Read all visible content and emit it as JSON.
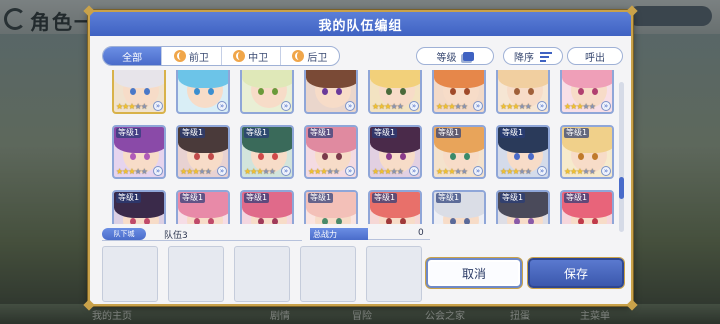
{
  "background": {
    "title": "角色一览",
    "nav_labels": [
      "我的主页",
      "剧情",
      "冒险",
      "公会之家",
      "扭蛋",
      "主菜单"
    ]
  },
  "dialog": {
    "title": "我的队伍编组",
    "filter_tabs": [
      "全部",
      "前卫",
      "中卫",
      "后卫"
    ],
    "active_tab": "全部",
    "sort_level_label": "等级",
    "sort_order_label": "降序",
    "callout_label": "呼出"
  },
  "roster": {
    "rows": [
      [
        {
          "level": "",
          "stars": 3,
          "hair": "#e7e4ea",
          "eye": "#4a78c8",
          "bg": "#f0e2cf",
          "selected": true
        },
        {
          "level": "",
          "stars": 0,
          "hair": "#6cc4e8",
          "eye": "#3b8ed0",
          "bg": "#d9eef6"
        },
        {
          "level": "",
          "stars": 0,
          "hair": "#dfe8b8",
          "eye": "#6a9a3a",
          "bg": "#e9efd5"
        },
        {
          "level": "",
          "stars": 0,
          "hair": "#7a4a36",
          "eye": "#6a3a9a",
          "bg": "#ead6cc"
        },
        {
          "level": "",
          "stars": 3,
          "hair": "#f2d07a",
          "eye": "#4a6a3a",
          "bg": "#f3e3c2"
        },
        {
          "level": "",
          "stars": 3,
          "hair": "#e6874a",
          "eye": "#a04a2a",
          "bg": "#f3dac8"
        },
        {
          "level": "",
          "stars": 3,
          "hair": "#f1cfa0",
          "eye": "#a0603a",
          "bg": "#f6e6d4"
        },
        {
          "level": "",
          "stars": 3,
          "hair": "#ef9fb8",
          "eye": "#b04070",
          "bg": "#f8dfe7"
        }
      ],
      [
        {
          "level": "等级1",
          "stars": 3,
          "hair": "#8a4aa8",
          "eye": "#b05ab8",
          "bg": "#e6d4ee"
        },
        {
          "level": "等级1",
          "stars": 3,
          "hair": "#4a3a3a",
          "eye": "#c04a4a",
          "bg": "#e8d2d2"
        },
        {
          "level": "等级1",
          "stars": 3,
          "hair": "#3a6a5a",
          "eye": "#d04a4a",
          "bg": "#d2e4dc"
        },
        {
          "level": "等级1",
          "stars": 3,
          "hair": "#e08aa0",
          "eye": "#7a3a4a",
          "bg": "#f4dbe2"
        },
        {
          "level": "等级1",
          "stars": 3,
          "hair": "#4a2a4a",
          "eye": "#8a3a8a",
          "bg": "#e2d0e2"
        },
        {
          "level": "等级1",
          "stars": 3,
          "hair": "#e8a45a",
          "eye": "#3a8a6a",
          "bg": "#f4e2cc"
        },
        {
          "level": "等级1",
          "stars": 3,
          "hair": "#2a3a5a",
          "eye": "#4a6ac8",
          "bg": "#d4dbea"
        },
        {
          "level": "等级1",
          "stars": 3,
          "hair": "#f0d08a",
          "eye": "#c07a2a",
          "bg": "#f6eacc"
        },
        {
          "level": "等级1",
          "stars": 3,
          "hair": "#f3b8c8",
          "eye": "#4a8ad8",
          "bg": "#fae6ec"
        }
      ],
      [
        {
          "level": "等级1",
          "stars": 0,
          "hair": "#3a2a4a",
          "eye": "#c04a6a",
          "bg": "#dcd0e4"
        },
        {
          "level": "等级1",
          "stars": 0,
          "hair": "#e88aa8",
          "eye": "#c04a6a",
          "bg": "#f6dde6"
        },
        {
          "level": "等级1",
          "stars": 0,
          "hair": "#e06a8a",
          "eye": "#a03a5a",
          "bg": "#f4d6e0"
        },
        {
          "level": "等级1",
          "stars": 0,
          "hair": "#f3c0b8",
          "eye": "#4a8a6a",
          "bg": "#fae4e0"
        },
        {
          "level": "等级1",
          "stars": 0,
          "hair": "#e8706a",
          "eye": "#a03a3a",
          "bg": "#f6d8d6"
        },
        {
          "level": "等级1",
          "stars": 0,
          "hair": "#dadde6",
          "eye": "#5a6a9a",
          "bg": "#eeeff4"
        },
        {
          "level": "等级1",
          "stars": 0,
          "hair": "#4a4a5a",
          "eye": "#8a5aa8",
          "bg": "#dedee6"
        },
        {
          "level": "等级1",
          "stars": 0,
          "hair": "#e8647a",
          "eye": "#c03a4a",
          "bg": "#f6d6dc"
        }
      ]
    ]
  },
  "team": {
    "tag": "队下城",
    "name": "队伍3",
    "power_label": "总战力",
    "power_value": "0"
  },
  "buttons": {
    "cancel": "取消",
    "save": "保存"
  },
  "colors": {
    "accent": "#4a6cca",
    "header": "#3f62c2",
    "gold_border": "#c9a24a",
    "star": "#f2c230"
  }
}
